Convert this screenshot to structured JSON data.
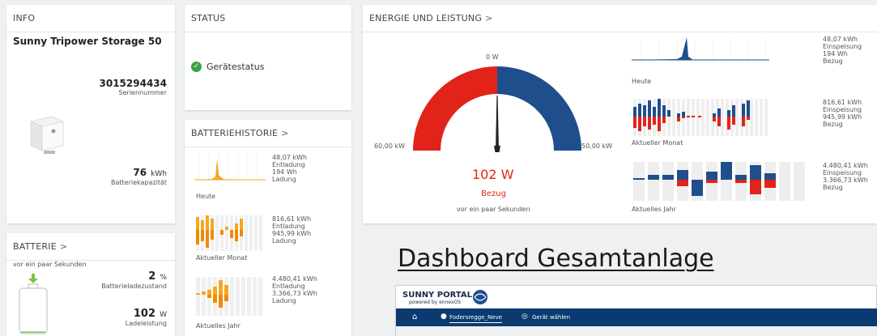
{
  "info": {
    "title": "INFO",
    "device_name": "Sunny Tripower Storage 50",
    "serial": "3015294434",
    "serial_label": "Seriennummer",
    "capacity_value": "76",
    "capacity_unit": "kWh",
    "capacity_label": "Batteriekapazität"
  },
  "status": {
    "title": "STATUS",
    "device_status": "Gerätestatus",
    "status_color": "#3aa14a"
  },
  "battery_history": {
    "title": "BATTERIEHISTORIE",
    "rows": [
      {
        "v1": "48,07 kWh",
        "l1": "Entladung",
        "v2": "194 Wh",
        "l2": "Ladung",
        "period": "Heute"
      },
      {
        "v1": "816,61 kWh",
        "l1": "Entladung",
        "v2": "945,99 kWh",
        "l2": "Ladung",
        "period": "Aktueller Monat"
      },
      {
        "v1": "4.480,41 kWh",
        "l1": "Entladung",
        "v2": "3.366,73 kWh",
        "l2": "Ladung",
        "period": "Aktuelles Jahr"
      }
    ]
  },
  "battery": {
    "title": "BATTERIE",
    "time": "vor ein paar Sekunden",
    "soc_value": "2",
    "soc_unit": "%",
    "soc_label": "Batterieladezustand",
    "soc_fraction": 0.02,
    "power_value": "102",
    "power_unit": "W",
    "power_label": "Ladeleistung"
  },
  "energy": {
    "title": "ENERGIE UND LEISTUNG",
    "gauge_top": "0 W",
    "gauge_left": "60,00 kW",
    "gauge_right": "50,00 kW",
    "value": "102 W",
    "direction": "Bezug",
    "time": "vor ein paar Sekunden",
    "rows": [
      {
        "v1": "48,07 kWh",
        "l1": "Einspeisung",
        "v2": "194 Wh",
        "l2": "Bezug",
        "period": "Heute"
      },
      {
        "v1": "816,61 kWh",
        "l1": "Einspeisung",
        "v2": "945,99 kWh",
        "l2": "Bezug",
        "period": "Aktueller Monat"
      },
      {
        "v1": "4.480,41 kWh",
        "l1": "Einspeisung",
        "v2": "3.366,73 kWh",
        "l2": "Bezug",
        "period": "Aktuelles Jahr"
      }
    ]
  },
  "overlay": {
    "heading": "Dashboard Gesamtanlage",
    "portal_name": "SUNNY PORTAL",
    "portal_sub": "powered by ennexOS",
    "nav_plant": "Fodersregge_Neve",
    "nav_device": "Gerät wählen"
  },
  "colors": {
    "feed": "#1f4e8c",
    "draw": "#e2231a",
    "accent": "#f5a623",
    "battery_green": "#7cc242"
  }
}
